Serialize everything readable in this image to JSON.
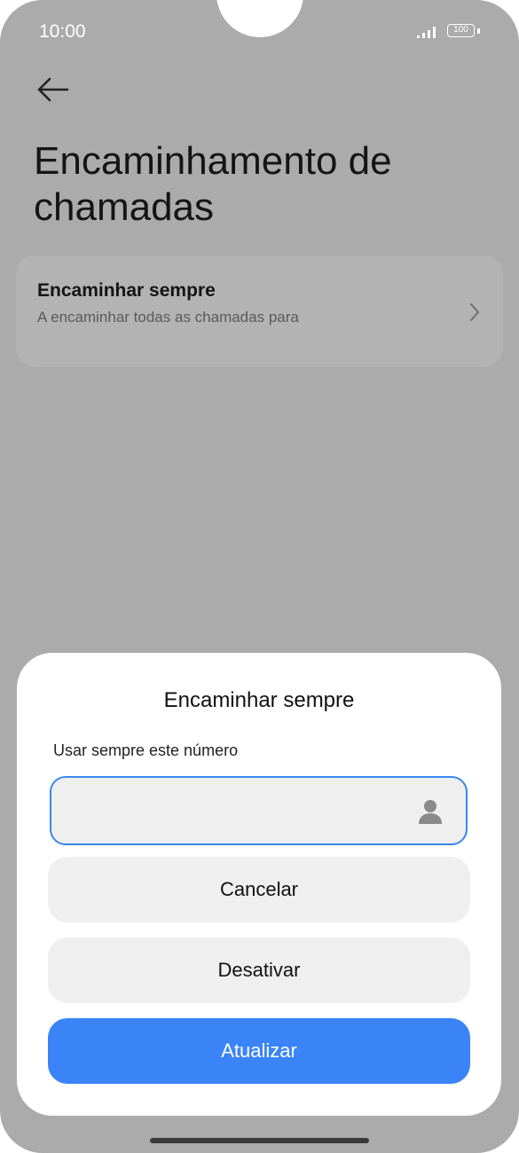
{
  "status_bar": {
    "time": "10:00",
    "battery": "100"
  },
  "page": {
    "title": "Encaminhamento de chamadas",
    "back_icon": "arrow-left-icon"
  },
  "option": {
    "title": "Encaminhar sempre",
    "subtitle": "A encaminhar todas as chamadas para",
    "chevron_icon": "chevron-right-icon"
  },
  "dialog": {
    "title": "Encaminhar sempre",
    "label": "Usar sempre este número",
    "input_value": "",
    "contact_icon": "person-icon",
    "cancel_label": "Cancelar",
    "disable_label": "Desativar",
    "update_label": "Atualizar"
  },
  "colors": {
    "accent": "#3a84f7",
    "scrim": "#ababab",
    "field_border": "#3a86ee"
  }
}
